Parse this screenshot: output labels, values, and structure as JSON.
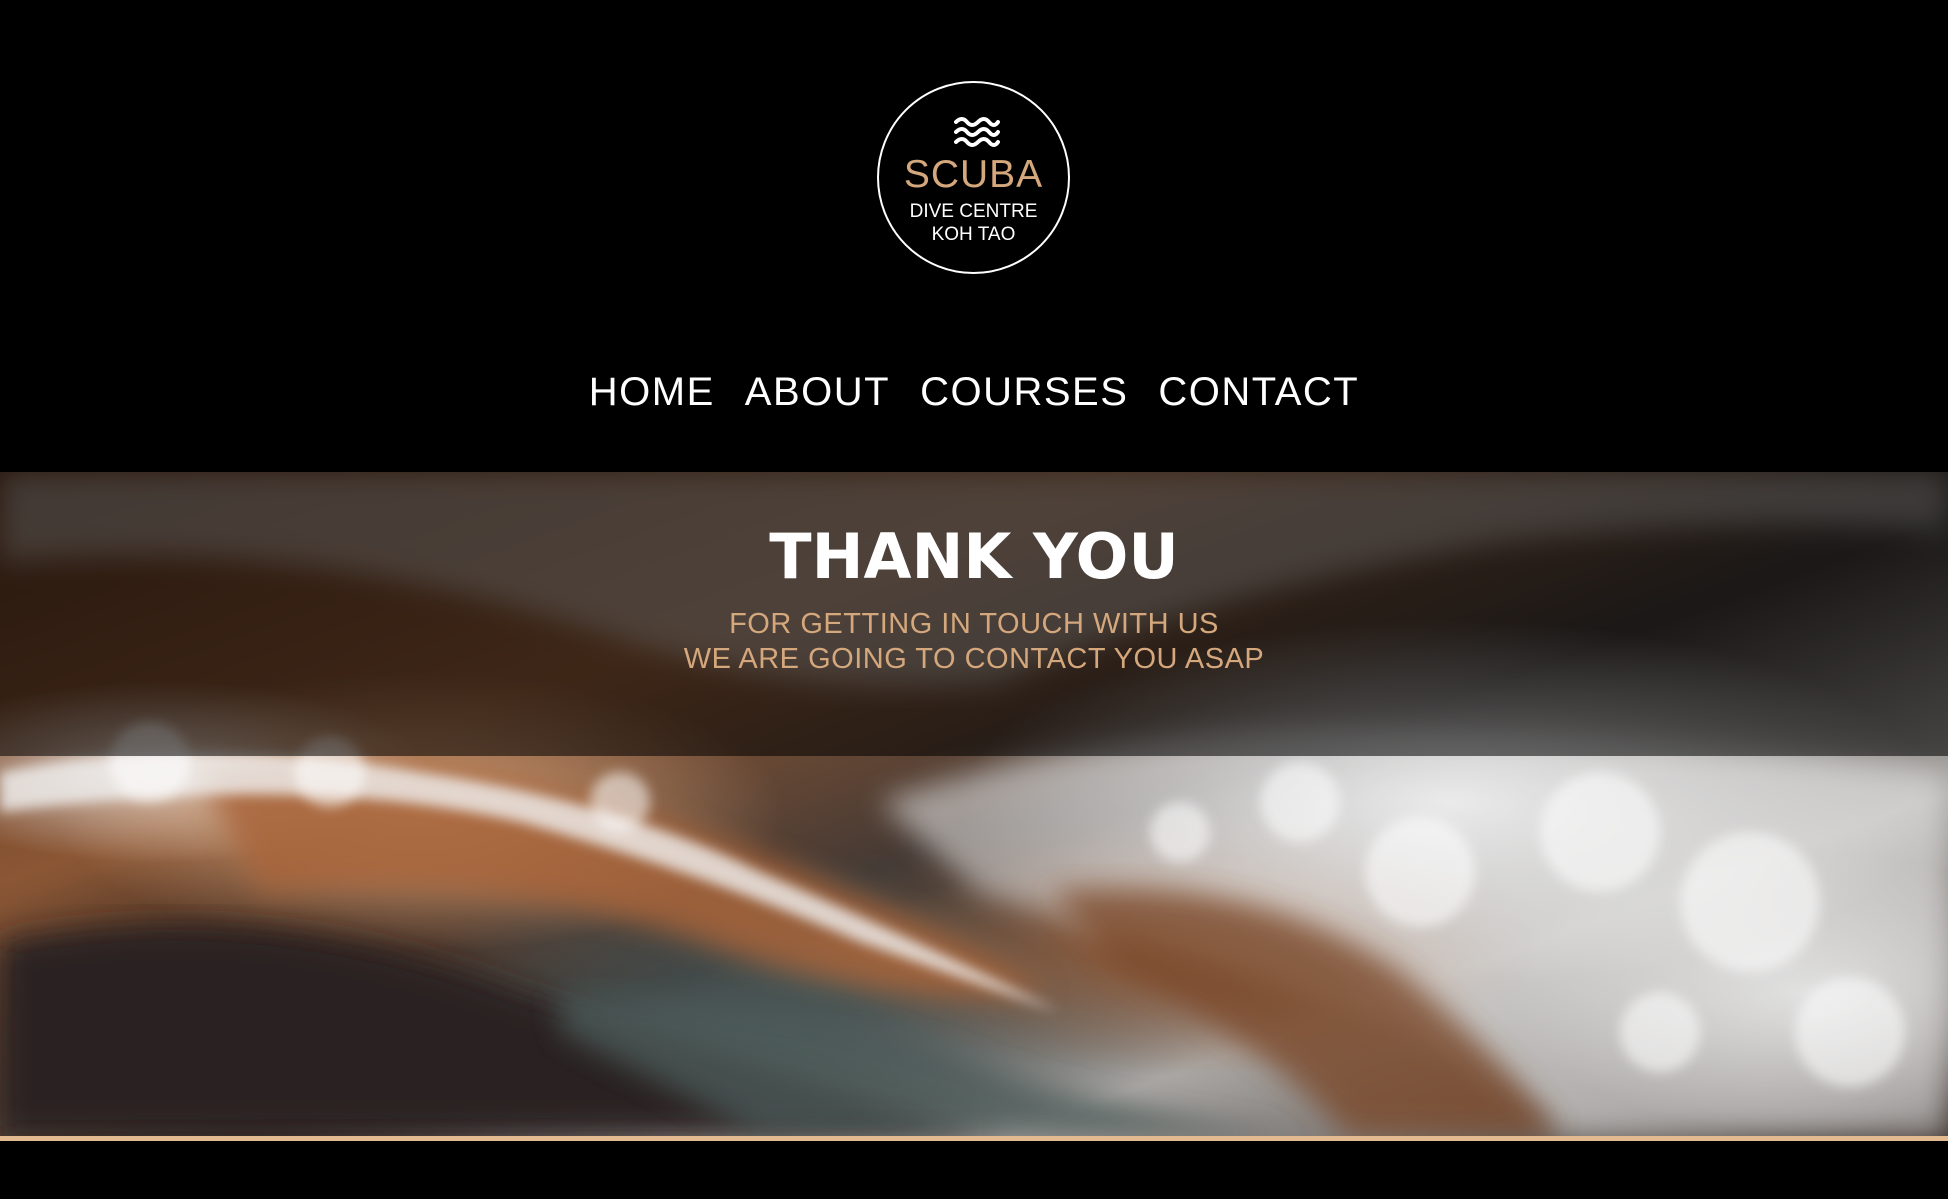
{
  "logo": {
    "icon": "waves-icon",
    "title": "SCUBA",
    "line1": "DIVE CENTRE",
    "line2": "KOH TAO"
  },
  "nav": {
    "items": [
      {
        "label": "HOME"
      },
      {
        "label": "ABOUT"
      },
      {
        "label": "COURSES"
      },
      {
        "label": "CONTACT"
      }
    ]
  },
  "hero": {
    "title": "THANK YOU",
    "line1": "FOR GETTING IN TOUCH WITH US",
    "line2": "WE ARE GOING TO CONTACT YOU ASAP"
  },
  "colors": {
    "background": "#000000",
    "accent": "#d4a77c",
    "text": "#ffffff",
    "accent_line": "#e3b990"
  }
}
